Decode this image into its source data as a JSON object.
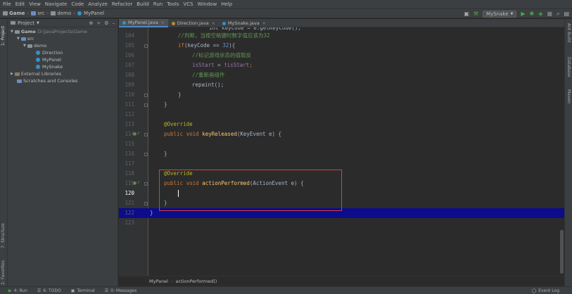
{
  "menu": [
    "File",
    "Edit",
    "View",
    "Navigate",
    "Code",
    "Analyze",
    "Refactor",
    "Build",
    "Run",
    "Tools",
    "VCS",
    "Window",
    "Help"
  ],
  "navbar": {
    "crumbs": [
      "Game",
      "src",
      "demo",
      "MyPanel"
    ],
    "run_config": "MySnake"
  },
  "left_tool_tabs": [
    "1: Project",
    "7: Structure",
    "2: Favorites"
  ],
  "right_tool_tabs": [
    "Ant Build",
    "Database",
    "Maven"
  ],
  "project_panel": {
    "title": "Project",
    "tree": {
      "root": "Game",
      "root_path": "D:\\JavaProjects\\Game",
      "src": "src",
      "package": "demo",
      "classes": [
        "Direction",
        "MyPanel",
        "MySnake"
      ],
      "external": "External Libraries",
      "scratches": "Scratches and Consoles"
    }
  },
  "editor": {
    "tabs": [
      {
        "label": "MyPanel.java"
      },
      {
        "label": "Direction.java"
      },
      {
        "label": "MySnake.java"
      }
    ],
    "partial_line": "int keyCode = e.getKeyCode();",
    "line_numbers": [
      "104",
      "105",
      "106",
      "107",
      "108",
      "109",
      "110",
      "111",
      "112",
      "113",
      "114",
      "115",
      "116",
      "117",
      "118",
      "119",
      "120",
      "121",
      "122",
      "123"
    ],
    "code": {
      "l104": "//判断，当按空格键时数字值应该为32",
      "l105_kw": "if",
      "l105_a": "(keyCode == ",
      "l105_num": "32",
      "l105_b": "){",
      "l106": "//标记游戏状态的值取反",
      "l107_f1": "isStart",
      "l107_a": " = !",
      "l107_f2": "isStart",
      "l107_b": ";",
      "l108": "//重新画组件",
      "l109": "repaint();",
      "l110": "}",
      "l111": "}",
      "l113": "@Override",
      "l114_kw": "public void ",
      "l114_fn": "keyReleased",
      "l114_rest": "(KeyEvent e) {",
      "l116": "}",
      "l118": "@Override",
      "l119_kw": "public void ",
      "l119_fn": "actionPerformed",
      "l119_rest": "(ActionEvent e) {",
      "l121": "}",
      "l122": "}"
    },
    "breadcrumb": [
      "MyPanel",
      "actionPerformed()"
    ]
  },
  "bottom_tabs": [
    "4: Run",
    "6: TODO",
    "Terminal",
    "0: Messages"
  ],
  "event_log": "Event Log",
  "colors": {
    "background": "#2b2b2b",
    "keyword": "#cc7832",
    "comment": "#629755",
    "annotation": "#bbb529",
    "method": "#ffc66d",
    "field": "#9876aa",
    "number": "#6897bb",
    "current_line": "#0c0c8c",
    "highlight_box": "#d84040"
  }
}
